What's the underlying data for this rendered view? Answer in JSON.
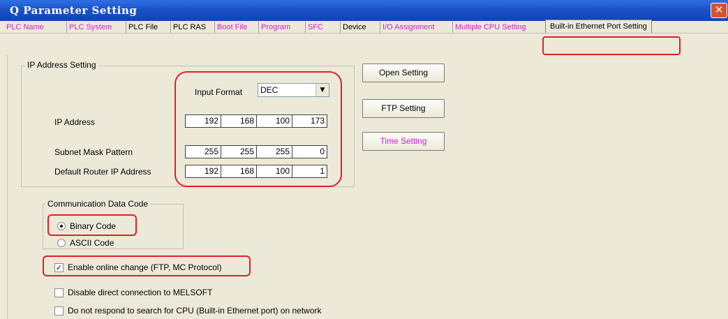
{
  "window": {
    "title": "Q Parameter Setting",
    "close_glyph": "✕"
  },
  "tabs": [
    {
      "label": "PLC Name",
      "color": "pink"
    },
    {
      "label": "PLC System",
      "color": "pink"
    },
    {
      "label": "PLC File",
      "color": "black"
    },
    {
      "label": "PLC RAS",
      "color": "black"
    },
    {
      "label": "Boot File",
      "color": "pink"
    },
    {
      "label": "Program",
      "color": "pink"
    },
    {
      "label": "SFC",
      "color": "pink"
    },
    {
      "label": "Device",
      "color": "black"
    },
    {
      "label": "I/O Assignment",
      "color": "pink"
    },
    {
      "label": "Multiple CPU Setting",
      "color": "pink"
    },
    {
      "label": "Built-in Ethernet Port Setting",
      "color": "active"
    }
  ],
  "ip_group": {
    "title": "IP Address Setting",
    "input_format_label": "Input Format",
    "input_format_value": "DEC",
    "ip_address": {
      "label": "IP Address",
      "octets": [
        "192",
        "168",
        "100",
        "173"
      ]
    },
    "subnet_mask": {
      "label": "Subnet Mask Pattern",
      "octets": [
        "255",
        "255",
        "255",
        "0"
      ]
    },
    "default_router": {
      "label": "Default Router IP Address",
      "octets": [
        "192",
        "168",
        "100",
        "1"
      ]
    }
  },
  "buttons": {
    "open_setting": "Open Setting",
    "ftp_setting": "FTP Setting",
    "time_setting": "Time Setting"
  },
  "comm_group": {
    "title": "Communication Data Code",
    "binary_label": "Binary Code",
    "ascii_label": "ASCII Code",
    "selected": "Binary Code"
  },
  "checkboxes": {
    "enable_online_change": {
      "label": "Enable online change (FTP, MC Protocol)",
      "checked": true
    },
    "disable_direct_connection": {
      "label": "Disable direct connection to MELSOFT",
      "checked": false
    },
    "do_not_respond_search": {
      "label": "Do not respond to search for CPU (Built-in Ethernet port) on network",
      "checked": false
    }
  },
  "colors": {
    "title_bar": "#1b53c8",
    "highlight": "#e21f26",
    "tab_pink": "#cc22cc",
    "dialog_bg": "#ece9d8"
  }
}
